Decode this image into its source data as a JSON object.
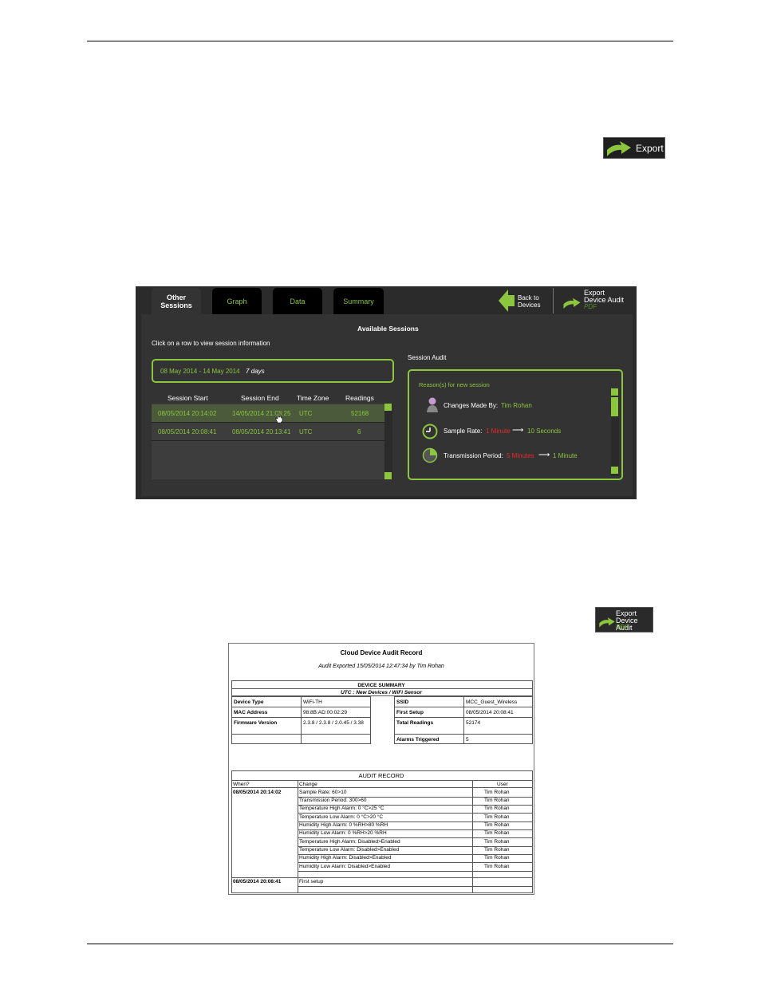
{
  "export_button": {
    "label": "Export"
  },
  "app": {
    "tabs": [
      {
        "label_line1": "Other",
        "label_line2": "Sessions"
      },
      {
        "label": "Graph"
      },
      {
        "label": "Data"
      },
      {
        "label": "Summary"
      }
    ],
    "back_button": {
      "line1": "Back to",
      "line2": "Devices"
    },
    "export_audit": {
      "line1": "Export",
      "line2": "Device Audit",
      "line3": "PDF"
    },
    "available_title": "Available Sessions",
    "instruction": "Click on a row to view session information",
    "date_range": "08 May 2014 - 14 May 2014",
    "duration": "7 days",
    "columns": [
      "Session Start",
      "Session End",
      "Time Zone",
      "Readings"
    ],
    "rows": [
      [
        "08/05/2014 20:14:02",
        "14/05/2014 21:08:25",
        "UTC",
        "52168"
      ],
      [
        "08/05/2014 20:08:41",
        "08/05/2014 20:13:41",
        "UTC",
        "6"
      ]
    ],
    "audit_title": "Session Audit",
    "reason_title": "Reason(s) for new session",
    "changes_label": "Changes Made By:",
    "changes_user": "Tim Rohan",
    "sample_label": "Sample Rate:",
    "sample_old": "1 Minute",
    "sample_new": "10 Seconds",
    "trans_label": "Transmission Period:",
    "trans_old": "5 Minutes",
    "trans_new": "1 Minute"
  },
  "export_pdf_button": {
    "line1": "Export",
    "line2": "Device Audit",
    "line3": "PDF"
  },
  "report": {
    "title": "Cloud Device Audit Record",
    "subtitle": "Audit Exported 15/05/2014 12:47:34 by Tim Rohan",
    "summary_title": "DEVICE SUMMARY",
    "summary_sub": "UTC : New Devices / WiFi Sensor",
    "left": [
      {
        "k": "Device Type",
        "v": "WiFi-TH"
      },
      {
        "k": "MAC Address",
        "v": "98:8B:AD:00:02:29"
      },
      {
        "k": "Firmware Version",
        "v": "2.3.8 / 2.3.8 / 2.0.45 / 3.38"
      }
    ],
    "right": [
      {
        "k": "SSID",
        "v": "MCC_Guest_Wireless"
      },
      {
        "k": "First Setup",
        "v": "08/05/2014 20:08:41"
      },
      {
        "k": "Total Readings",
        "v": "52174"
      },
      {
        "k": "Alarms Triggered",
        "v": "5"
      }
    ],
    "audit_title": "AUDIT RECORD",
    "audit_cols": [
      "When?",
      "Change",
      "User"
    ],
    "audit_rows": [
      {
        "when": "08/05/2014 20:14:02",
        "change": "Sample Rate: 60>10",
        "user": "Tim Rohan"
      },
      {
        "when": "",
        "change": "Transmission Period: 300>60",
        "user": "Tim Rohan"
      },
      {
        "when": "",
        "change": "Temperature High Alarm: 0 °C>25 °C",
        "user": "Tim Rohan"
      },
      {
        "when": "",
        "change": "Temperature Low Alarm: 0 °C>20 °C",
        "user": "Tim Rohan"
      },
      {
        "when": "",
        "change": "Humidity High Alarm: 0 %RH>80 %RH",
        "user": "Tim Rohan"
      },
      {
        "when": "",
        "change": "Humidity Low Alarm: 0 %RH>20 %RH",
        "user": "Tim Rohan"
      },
      {
        "when": "",
        "change": "Temperature High Alarm: Disabled>Enabled",
        "user": "Tim Rohan"
      },
      {
        "when": "",
        "change": "Temperature Low Alarm: Disabled>Enabled",
        "user": "Tim Rohan"
      },
      {
        "when": "",
        "change": "Humidity High Alarm: Disabled>Enabled",
        "user": "Tim Rohan"
      },
      {
        "when": "",
        "change": "Humidity Low Alarm: Disabled>Enabled",
        "user": "Tim Rohan"
      },
      {
        "when": "08/05/2014 20:08:41",
        "change": "First setup",
        "user": ""
      }
    ]
  }
}
